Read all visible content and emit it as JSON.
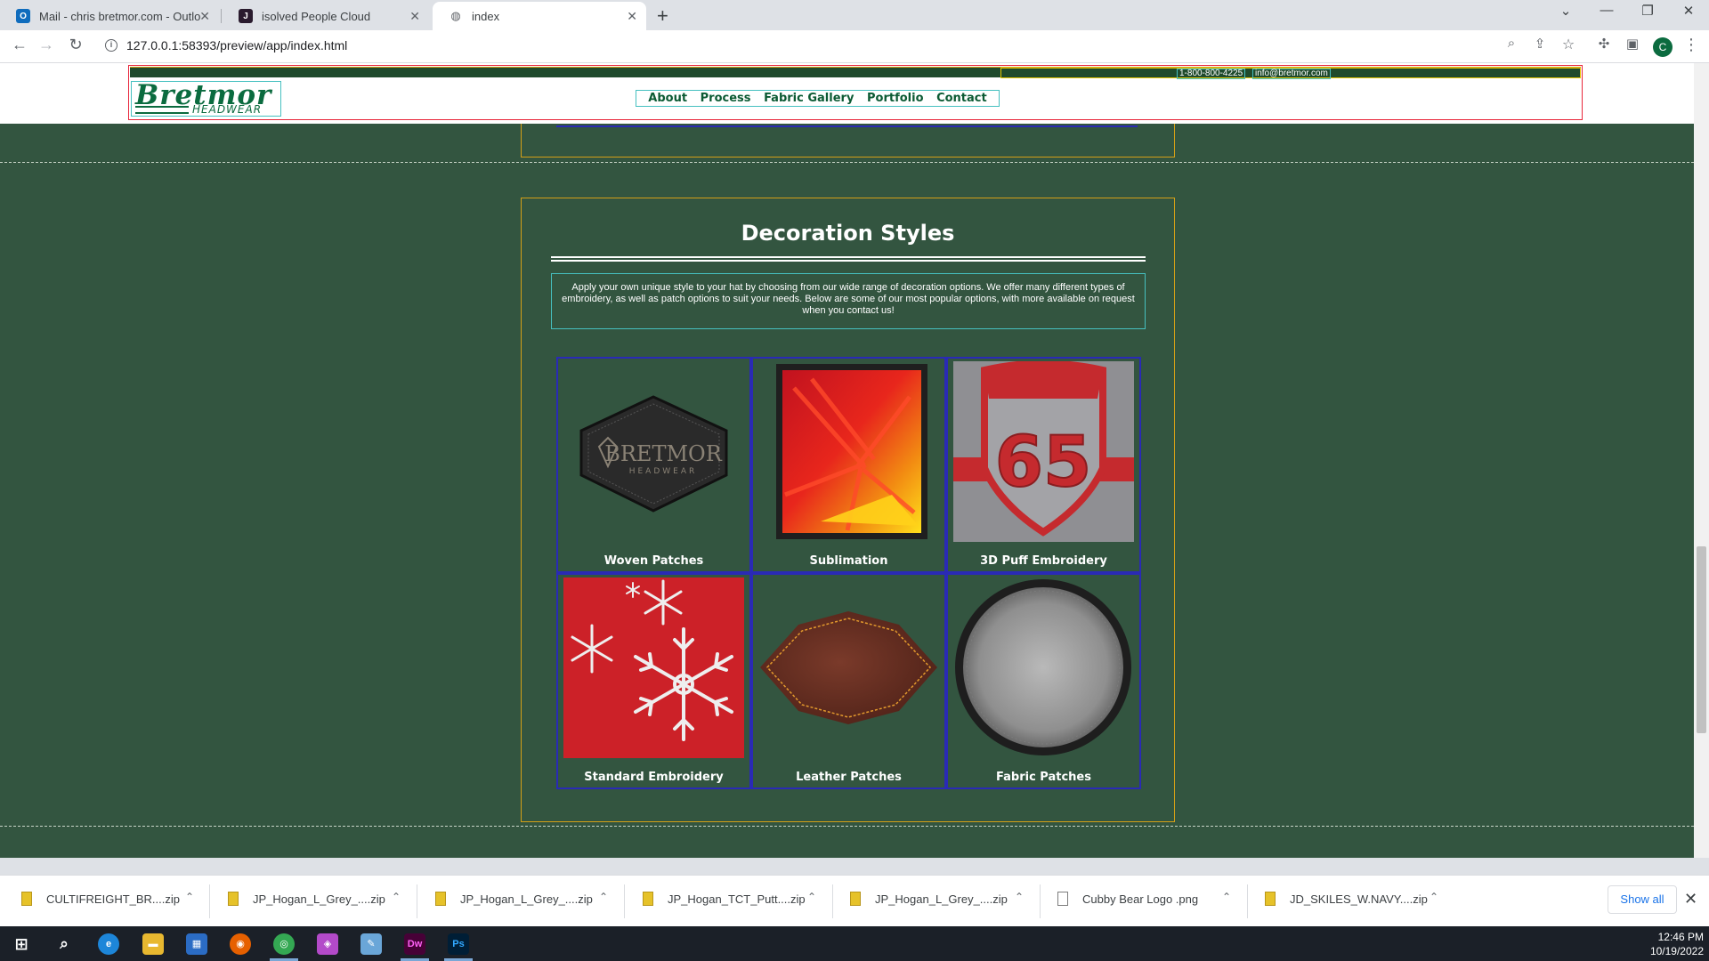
{
  "browser": {
    "tabs": [
      {
        "title": "Mail - chris bretmor.com - Outlo",
        "icon": "outlook-icon"
      },
      {
        "title": "isolved People Cloud",
        "icon": "isolved-icon"
      },
      {
        "title": "index",
        "icon": "globe-icon"
      }
    ],
    "url": "127.0.0.1:58393/preview/app/index.html",
    "profile_initial": "C"
  },
  "site": {
    "phone": "1-800-800-4225",
    "email": "info@bretmor.com",
    "logo_main": "Bretmor",
    "logo_sub": "HEADWEAR",
    "nav": [
      "About",
      "Process",
      "Fabric Gallery",
      "Portfolio",
      "Contact"
    ]
  },
  "decoration": {
    "title": "Decoration Styles",
    "intro": "Apply your own unique style to your hat by choosing from our wide range of decoration options. We offer many different types of embroidery, as well as patch options to suit your needs. Below are some of our most popular options, with more available on request when you contact us!",
    "items": [
      {
        "label": "Woven Patches",
        "image": "woven-patch-image",
        "patch_text": "BRETMOR",
        "patch_subtext": "HEADWEAR"
      },
      {
        "label": "Sublimation",
        "image": "sublimation-image"
      },
      {
        "label": "3D Puff Embroidery",
        "image": "puff-embroidery-image",
        "patch_text": "65"
      },
      {
        "label": "Standard Embroidery",
        "image": "standard-embroidery-image"
      },
      {
        "label": "Leather Patches",
        "image": "leather-patch-image"
      },
      {
        "label": "Fabric Patches",
        "image": "fabric-patch-image"
      }
    ]
  },
  "downloads": {
    "items": [
      {
        "name": "CULTIFREIGHT_BR....zip",
        "type": "zip"
      },
      {
        "name": "JP_Hogan_L_Grey_....zip",
        "type": "zip"
      },
      {
        "name": "JP_Hogan_L_Grey_....zip",
        "type": "zip"
      },
      {
        "name": "JP_Hogan_TCT_Putt....zip",
        "type": "zip"
      },
      {
        "name": "JP_Hogan_L_Grey_....zip",
        "type": "zip"
      },
      {
        "name": "Cubby Bear Logo .png",
        "type": "png"
      },
      {
        "name": "JD_SKILES_W.NAVY....zip",
        "type": "zip"
      }
    ],
    "show_all": "Show all"
  },
  "taskbar": {
    "time": "12:46 PM",
    "date": "10/19/2022",
    "dw_label": "Dw",
    "ps_label": "Ps"
  }
}
